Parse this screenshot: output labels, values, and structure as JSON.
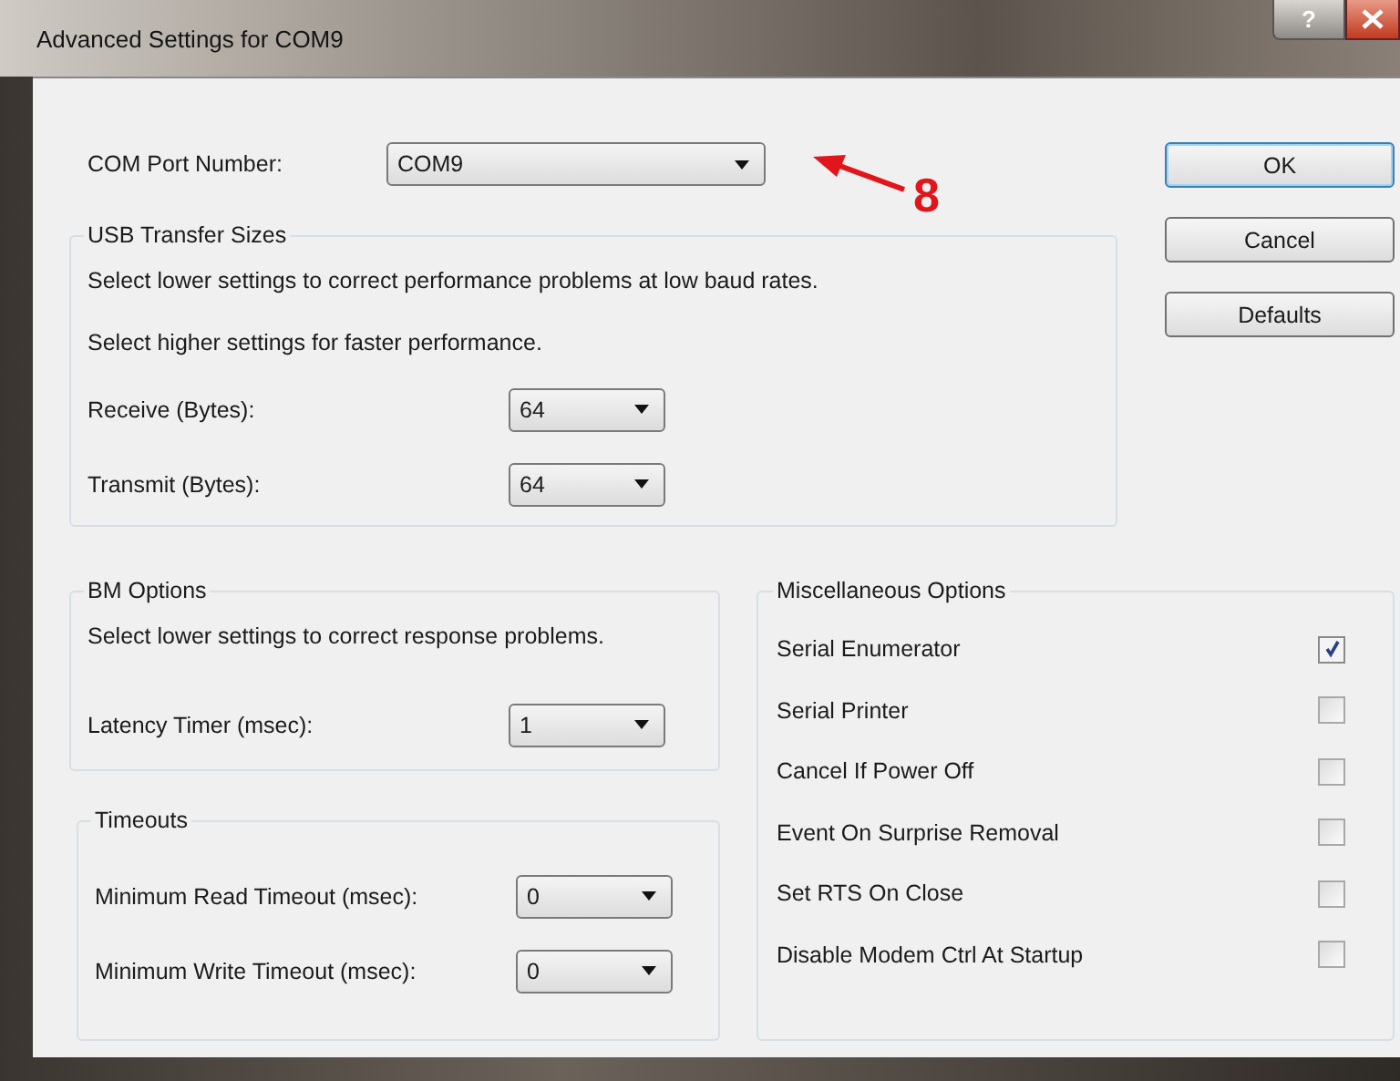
{
  "window": {
    "title": "Advanced Settings for COM9",
    "help_label": "?"
  },
  "com_port": {
    "label": "COM Port Number:",
    "value": "COM9"
  },
  "annotation": {
    "label": "8"
  },
  "buttons": [
    {
      "label": "OK",
      "default": true
    },
    {
      "label": "Cancel",
      "default": false
    },
    {
      "label": "Defaults",
      "default": false
    }
  ],
  "usb_transfer": {
    "title": "USB Transfer Sizes",
    "notes": [
      "Select lower settings to correct performance problems at low baud rates.",
      "Select higher settings for faster performance."
    ],
    "fields": [
      {
        "label": "Receive (Bytes):",
        "value": "64"
      },
      {
        "label": "Transmit (Bytes):",
        "value": "64"
      }
    ]
  },
  "bm_options": {
    "title": "BM Options",
    "note": "Select lower settings to correct response problems.",
    "fields": [
      {
        "label": "Latency Timer (msec):",
        "value": "1"
      }
    ]
  },
  "timeouts": {
    "title": "Timeouts",
    "fields": [
      {
        "label": "Minimum Read Timeout (msec):",
        "value": "0"
      },
      {
        "label": "Minimum Write Timeout (msec):",
        "value": "0"
      }
    ]
  },
  "misc": {
    "title": "Miscellaneous Options",
    "options": [
      {
        "label": "Serial Enumerator",
        "checked": true
      },
      {
        "label": "Serial Printer",
        "checked": false
      },
      {
        "label": "Cancel If Power Off",
        "checked": false
      },
      {
        "label": "Event On Surprise Removal",
        "checked": false
      },
      {
        "label": "Set RTS On Close",
        "checked": false
      },
      {
        "label": "Disable Modem Ctrl At Startup",
        "checked": false
      }
    ]
  }
}
